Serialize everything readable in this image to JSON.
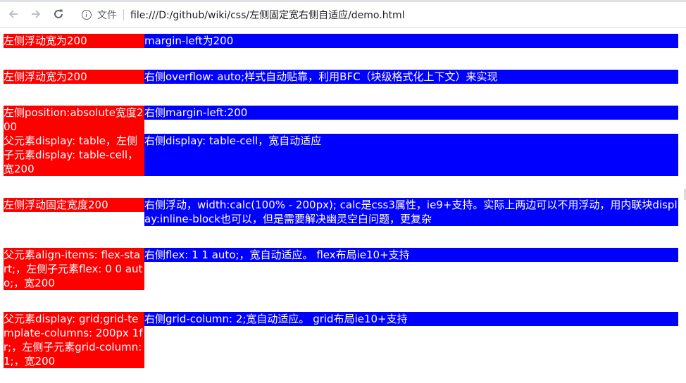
{
  "browser": {
    "back_icon": "arrow-left-icon",
    "forward_icon": "arrow-right-icon",
    "reload_icon": "reload-icon",
    "info_icon": "info-circle-icon",
    "scheme_label": "文件",
    "url": "file:///D:/github/wiki/css/左侧固定宽右侧自适应/demo.html"
  },
  "colors": {
    "left": "#ff0000",
    "right": "#0000ff",
    "text": "#ffffff"
  },
  "rows": [
    {
      "left": "左侧浮动宽为200",
      "right": "margin-left为200"
    },
    {
      "left": "左侧浮动宽为200",
      "right": "右侧overflow: auto;样式自动贴靠，利用BFC（块级格式化上下文）来实现"
    },
    {
      "left": "左侧position:absolute宽度200",
      "right": "右侧margin-left:200"
    },
    {
      "left": "父元素display: table，左侧子元素display: table-cell，宽200",
      "right": "右侧display: table-cell，宽自动适应"
    },
    {
      "left": "左侧浮动固定宽度200",
      "right": "右侧浮动，width:calc(100% - 200px); calc是css3属性，ie9+支持。实际上两边可以不用浮动，用内联块display:inline-block也可以，但是需要解决幽灵空白问题，更复杂"
    },
    {
      "left": "父元素align-items: flex-start;，左侧子元素flex: 0 0 auto;，宽200",
      "right": "右侧flex: 1 1 auto;，宽自动适应。 flex布局ie10+支持"
    },
    {
      "left": "父元素display: grid;grid-template-columns: 200px 1fr;，左侧子元素grid-column: 1;，宽200",
      "right": "右侧grid-column: 2;宽自动适应。 grid布局ie10+支持"
    }
  ]
}
